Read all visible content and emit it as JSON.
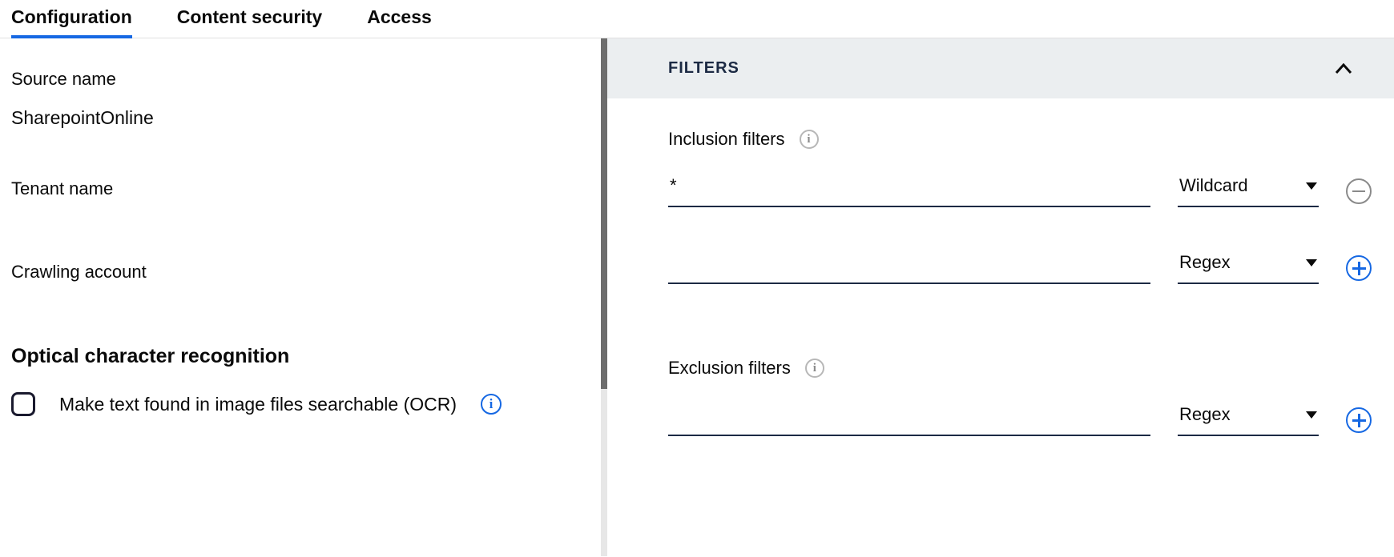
{
  "tabs": {
    "configuration": "Configuration",
    "content_security": "Content security",
    "access": "Access"
  },
  "left": {
    "source_name_label": "Source name",
    "source_name_value": "SharepointOnline",
    "tenant_name_label": "Tenant name",
    "tenant_name_value": "",
    "crawling_account_label": "Crawling account",
    "crawling_account_value": "",
    "ocr_heading": "Optical character recognition",
    "ocr_checkbox_label": "Make text found in image files searchable (OCR)"
  },
  "right": {
    "panel_title": "FILTERS",
    "inclusion_label": "Inclusion filters",
    "exclusion_label": "Exclusion filters",
    "inclusion_rows": [
      {
        "value": "*",
        "type": "Wildcard",
        "action": "remove"
      },
      {
        "value": "",
        "type": "Regex",
        "action": "add"
      }
    ],
    "exclusion_rows": [
      {
        "value": "",
        "type": "Regex",
        "action": "add"
      }
    ]
  }
}
